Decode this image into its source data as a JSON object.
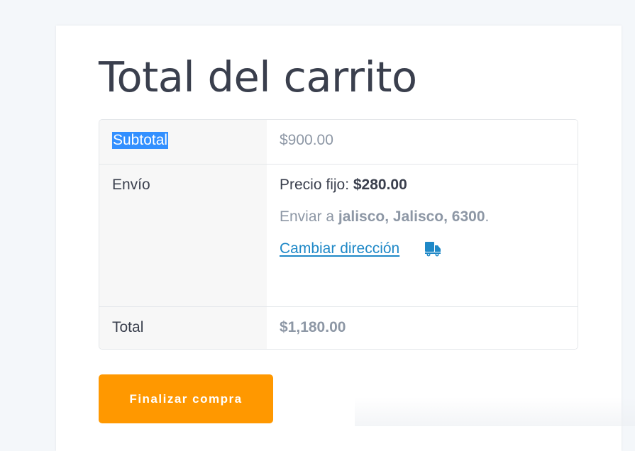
{
  "cart_totals": {
    "title": "Total del carrito",
    "subtotal": {
      "label": "Subtotal",
      "value": "$900.00"
    },
    "shipping": {
      "label": "Envío",
      "method_prefix": "Precio fijo: ",
      "method_price": "$280.00",
      "ship_to_prefix": "Enviar a ",
      "ship_to_address": "jalisco, Jalisco, 6300",
      "ship_to_suffix": ".",
      "change_address_link": "Cambiar dirección",
      "change_address_icon": "truck-icon"
    },
    "total": {
      "label": "Total",
      "value": "$1,180.00"
    },
    "checkout_button": "Finalizar compra"
  },
  "colors": {
    "accent_button": "#ff9800",
    "link": "#1e88c7",
    "selection": "#3390ff",
    "text_dark": "#3a3f4d",
    "text_muted": "#8d97a5"
  }
}
